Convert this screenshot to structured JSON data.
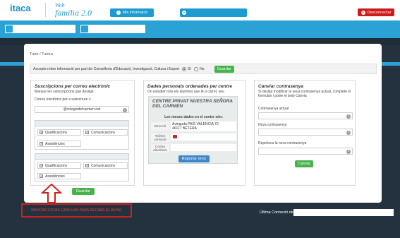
{
  "header": {
    "logo_text": "itaca",
    "app_web": "Web",
    "app_name": "família 2.0",
    "my_info_label": "Mis informació",
    "logout_label": "Desconnectar"
  },
  "breadcrumb": "Tutor / Tutora",
  "consent": {
    "text": "Accepte rebre informació per part de Conselleria d'Educació, Investigació, Cultura i Esport",
    "yes_label": "Sí",
    "no_label": "No",
    "selected": "Sí",
    "save_label": "Guardar"
  },
  "subscriptions": {
    "title": "Suscripcions per correu electrònic",
    "subtitle": "Marque les subscripcions que desitge",
    "email_label": "Correu electrònic per a subscriure´s",
    "email_value": "@colegiodelcarmen.net",
    "checks": [
      "Qualificacions",
      "Comunicacions",
      "Assistències"
    ],
    "save_label": "Guardar"
  },
  "personal": {
    "title": "Dades personals ordenades per centre",
    "subtitle": "On estudien tots els alumnes que té a càrrec seu",
    "school_name": "CENTRE PRIVAT NUESTRA SEÑORA DEL CARMEN",
    "my_data_label": "Les meues dades en el centre són:",
    "address_label": "Direcció",
    "address_value": "Avinguda PAIS VALENCIA 70\n46117 BÉTERA",
    "phone_label": "Telèfon contacte",
    "email_label": "Correu electrònic",
    "report_label": "Reportar error"
  },
  "password": {
    "title": "Canviar contrasenya",
    "subtitle": "Si desitja modificar la seua contrasenya actual, complete el formulari i polse el botó Canvia",
    "current_label": "Contrasenya actual",
    "new_label": "Nova contrasenya",
    "repeat_label": "Repetisca la nova contrasenya",
    "change_label": "Canvia"
  },
  "annotation": "MARCAR ESTAS CASILLAS PARA RECIBIR EL AVISO",
  "last_connection_label": "Última Connexió de",
  "colors": {
    "primary": "#2aa2d6",
    "green": "#46b34b",
    "red": "#cf1a1a",
    "dark": "#243240"
  }
}
